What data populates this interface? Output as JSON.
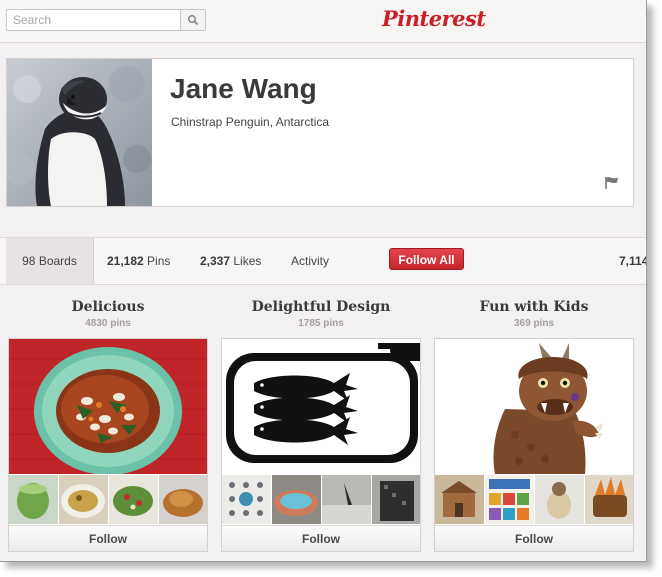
{
  "header": {
    "search_placeholder": "Search",
    "logo_text": "Pinterest",
    "brand_color": "#cb2027"
  },
  "profile": {
    "name": "Jane Wang",
    "location": "Chinstrap Penguin, Antarctica"
  },
  "stats": {
    "boards_count": "98",
    "boards_label": "Boards",
    "pins_count": "21,182",
    "pins_label": "Pins",
    "likes_count": "2,337",
    "likes_label": "Likes",
    "activity_label": "Activity",
    "follow_all_label": "Follow All",
    "followers_partial": "7,114"
  },
  "boards": [
    {
      "title": "Delicious",
      "pin_count": "4830 pins",
      "follow_label": "Follow"
    },
    {
      "title": "Delightful Design",
      "pin_count": "1785 pins",
      "follow_label": "Follow"
    },
    {
      "title": "Fun with Kids",
      "pin_count": "369 pins",
      "follow_label": "Follow"
    }
  ]
}
